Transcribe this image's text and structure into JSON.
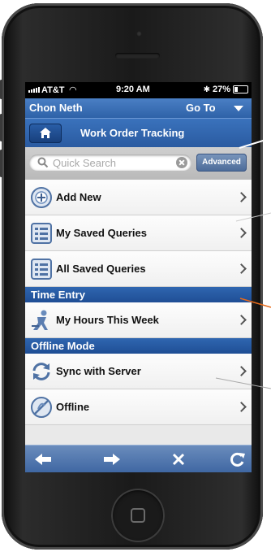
{
  "status_bar": {
    "carrier": "AT&T",
    "time": "9:20 AM",
    "battery": "27%",
    "battery_level": 0.27
  },
  "header": {
    "user_name": "Chon Neth",
    "goto_label": "Go To",
    "title": "Work Order Tracking"
  },
  "search": {
    "placeholder": "Quick Search",
    "advanced_label": "Advanced"
  },
  "menu": {
    "add_new": "Add New",
    "my_saved_queries": "My Saved Queries",
    "all_saved_queries": "All Saved Queries",
    "time_entry_header": "Time Entry",
    "my_hours": "My Hours This Week",
    "offline_header": "Offline Mode",
    "sync": "Sync with Server",
    "offline": "Offline"
  },
  "toolbar": {
    "icons": [
      "back-arrow-icon",
      "forward-arrow-icon",
      "close-icon",
      "refresh-icon"
    ]
  },
  "colors": {
    "header_blue": "#2e62a8",
    "section_blue": "#1f4e95",
    "toolbar_blue": "#4e73ab"
  }
}
